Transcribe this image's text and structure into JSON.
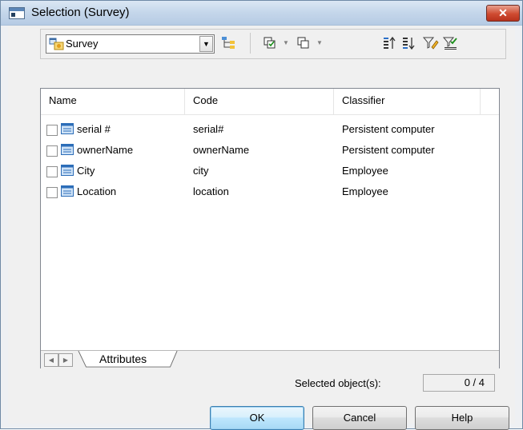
{
  "window": {
    "title": "Selection (Survey)",
    "close_glyph": "✕"
  },
  "toolbar": {
    "combo": {
      "value": "Survey",
      "icon": "package-icon"
    },
    "buttons": [
      {
        "name": "hierarchy-icon"
      },
      {
        "name": "select-all-icon"
      },
      {
        "name": "deselect-all-icon"
      },
      {
        "name": "move-to-top-icon"
      },
      {
        "name": "move-to-bottom-icon"
      },
      {
        "name": "filter-icon"
      },
      {
        "name": "filter-selected-icon"
      }
    ]
  },
  "list": {
    "columns": [
      "Name",
      "Code",
      "Classifier"
    ],
    "rows": [
      {
        "name": "serial #",
        "code": "serial#",
        "classifier": "Persistent computer"
      },
      {
        "name": "ownerName",
        "code": "ownerName",
        "classifier": "Persistent computer"
      },
      {
        "name": "City",
        "code": "city",
        "classifier": "Employee"
      },
      {
        "name": "Location",
        "code": "location",
        "classifier": "Employee"
      }
    ],
    "tab": "Attributes"
  },
  "status": {
    "selected_label": "Selected object(s):",
    "selected_value": "0 / 4"
  },
  "buttons": {
    "ok": "OK",
    "cancel": "Cancel",
    "help": "Help"
  },
  "colors": {
    "accent_blue": "#3c7fb1",
    "close_red": "#cf4b31",
    "title_bar": "#c4d6ea"
  }
}
